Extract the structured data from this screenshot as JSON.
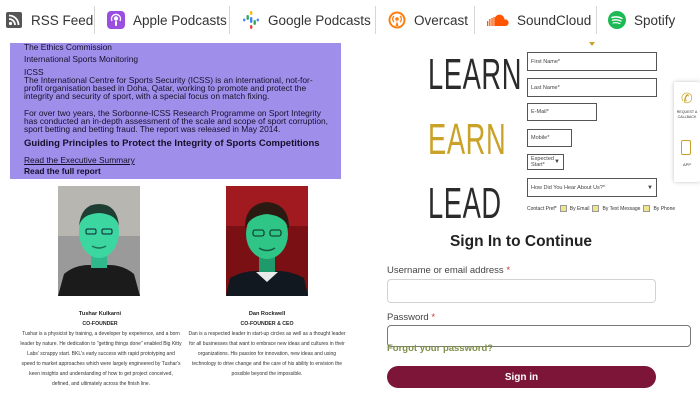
{
  "podcast_bar": {
    "rss": "RSS Feed",
    "apple": "Apple Podcasts",
    "google": "Google Podcasts",
    "overcast": "Overcast",
    "soundcloud": "SoundCloud",
    "spotify": "Spotify"
  },
  "panel": {
    "line0": "The Ethics Commission",
    "line1": "International Sports Monitoring",
    "line2": "ICSS",
    "para1": "The International Centre for Sports Security (ICSS) is an international, not-for-profit organisation based in Doha, Qatar, working to promote and protect the integrity and security of sport, with a special focus on match fixing.",
    "para2": "For over two years, the Sorbonne-ICSS Research Programme on Sport Integrity has conducted an in-depth assessment of the scale and scope of sport corruption, sport betting and betting fraud. The report was released in May 2014.",
    "heading": "Guiding Principles to Protect the Integrity of Sports Competitions",
    "link1": "Read the Executive Summary",
    "link2": "Read the full report"
  },
  "people": [
    {
      "name": "Tushar Kulkarni",
      "role": "CO-FOUNDER",
      "bio": "Tushar is a physicist by training, a developer by experience, and a born leader by nature. He dedication to \"getting things done\" enabled Big Kitty Labs' scrappy start. BKL's early success with rapid prototyping and speed to market approaches which were largely engineered by Tushar's keen insights and understanding of how to get project conceived, defined, and ultimately across the finish line."
    },
    {
      "name": "Dan Rockwell",
      "role": "CO-FOUNDER & CEO",
      "bio": "Dan is a respected leader in start-up circles as well as a thought leader for all businesses that want to embrace new ideas and cultures in their organizations. His passion for innovation, new ideas and using technology to drive change and the care of his ability to envision the possible beyond the impossible."
    }
  ],
  "slogan": {
    "learn": "LEARN",
    "earn": "EARN",
    "lead": "LEAD"
  },
  "mini_form": {
    "first_name": "First Name*",
    "last_name": "Last Name*",
    "email": "E-Mail*",
    "mobile": "Mobile*",
    "expected_start": "Expected Start*",
    "heard": "How Did You Hear About Us?*",
    "contact_pref": "Contact Pref*",
    "opt_email": "By Email",
    "opt_text": "By Text Message",
    "opt_phone": "By Phone"
  },
  "side_widget": {
    "request": "REQUEST A CALLBACK",
    "app": "APP"
  },
  "signin": {
    "title": "Sign In to Continue",
    "user_label": "Username or email address",
    "password_label": "Password",
    "required": "*",
    "forgot": "Forgot your password?",
    "button": "Sign in"
  },
  "colors": {
    "panel_bg": "#a08fea",
    "earn_gold": "#c9a227",
    "signin_button": "#7d1538",
    "forgot_link": "#80904a"
  }
}
